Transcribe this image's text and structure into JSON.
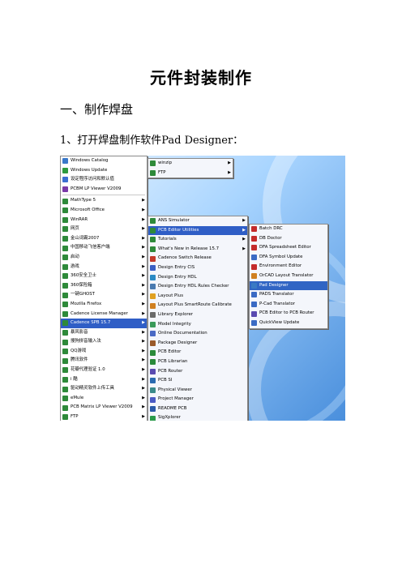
{
  "doc": {
    "title": "元件封装制作",
    "section": "一、制作焊盘",
    "step": "1、打开焊盘制作软件Pad Designer："
  },
  "start_menu": {
    "pinned": [
      {
        "label": "Windows Catalog",
        "icon": "catalog-icon",
        "color": "#3a78c9"
      },
      {
        "label": "Windows Update",
        "icon": "update-icon",
        "color": "#2d9a3e"
      },
      {
        "label": "设定程序访问和默认值",
        "icon": "defaults-icon",
        "color": "#3b6fd1"
      },
      {
        "label": "PCBM LP Viewer V2009",
        "icon": "viewer-icon",
        "color": "#7a3aa8"
      }
    ],
    "items": [
      {
        "label": "MathType 5",
        "icon": "program-folder-icon",
        "color": "#2e8a3a",
        "arrow": "▶"
      },
      {
        "label": "Microsoft Office",
        "icon": "program-folder-icon",
        "color": "#2e8a3a",
        "arrow": "▶"
      },
      {
        "label": "WinRAR",
        "icon": "program-folder-icon",
        "color": "#2e8a3a",
        "arrow": "▶"
      },
      {
        "label": "网页",
        "icon": "program-folder-icon",
        "color": "#2e8a3a",
        "arrow": "▶"
      },
      {
        "label": "金山词霸2007",
        "icon": "program-folder-icon",
        "color": "#2e8a3a",
        "arrow": "▶"
      },
      {
        "label": "中国移动飞信客户端",
        "icon": "program-folder-icon",
        "color": "#2e8a3a",
        "arrow": "▶"
      },
      {
        "label": "启动",
        "icon": "program-folder-icon",
        "color": "#2e8a3a",
        "arrow": "▶"
      },
      {
        "label": "游戏",
        "icon": "program-folder-icon",
        "color": "#2e8a3a",
        "arrow": "▶"
      },
      {
        "label": "360安全卫士",
        "icon": "program-folder-icon",
        "color": "#2e8a3a",
        "arrow": "▶"
      },
      {
        "label": "360保险箱",
        "icon": "program-folder-icon",
        "color": "#2e8a3a",
        "arrow": "▶"
      },
      {
        "label": "一键GHOST",
        "icon": "program-folder-icon",
        "color": "#2e8a3a",
        "arrow": "▶"
      },
      {
        "label": "Mozilla Firefox",
        "icon": "program-folder-icon",
        "color": "#2e8a3a",
        "arrow": "▶"
      },
      {
        "label": "Cadence License Manager",
        "icon": "program-folder-icon",
        "color": "#2e8a3a",
        "arrow": "▶"
      },
      {
        "label": "Cadence SPB 15.7",
        "icon": "program-folder-icon",
        "color": "#2e8a3a",
        "arrow": "▶",
        "active": true
      },
      {
        "label": "暴风影音",
        "icon": "program-folder-icon",
        "color": "#2e8a3a",
        "arrow": "▶"
      },
      {
        "label": "搜狗拼音输入法",
        "icon": "program-folder-icon",
        "color": "#2e8a3a",
        "arrow": "▶"
      },
      {
        "label": "QQ游戏",
        "icon": "program-folder-icon",
        "color": "#2e8a3a",
        "arrow": "▶"
      },
      {
        "label": "腾讯软件",
        "icon": "program-folder-icon",
        "color": "#2e8a3a",
        "arrow": "▶"
      },
      {
        "label": "花瓣代理验证 1.0",
        "icon": "program-folder-icon",
        "color": "#2e8a3a",
        "arrow": "▶"
      },
      {
        "label": "i 酷",
        "icon": "program-folder-icon",
        "color": "#2e8a3a",
        "arrow": "▶"
      },
      {
        "label": "驱动精灵软件上传工具",
        "icon": "program-folder-icon",
        "color": "#2e8a3a",
        "arrow": "▶"
      },
      {
        "label": "eMule",
        "icon": "program-folder-icon",
        "color": "#2e8a3a",
        "arrow": "▶"
      },
      {
        "label": "PCB Matrix LP Viewer V2009",
        "icon": "program-folder-icon",
        "color": "#2e8a3a",
        "arrow": "▶"
      },
      {
        "label": "FTP",
        "icon": "program-folder-icon",
        "color": "#2e8a3a",
        "arrow": "▶"
      }
    ]
  },
  "top_submenu": {
    "items": [
      {
        "label": "winzip",
        "icon": "program-folder-icon",
        "color": "#2e8a3a",
        "arrow": "▶"
      },
      {
        "label": "FTP",
        "icon": "program-folder-icon",
        "color": "#2e8a3a",
        "arrow": "▶"
      }
    ]
  },
  "cadence_menu": {
    "items": [
      {
        "label": "ANS Simulator",
        "icon": "program-folder-icon",
        "color": "#2e8a3a",
        "arrow": "▶"
      },
      {
        "label": "PCB Editor Utilities",
        "icon": "program-folder-icon",
        "color": "#2e8a3a",
        "arrow": "▶",
        "active": true
      },
      {
        "label": "Tutorials",
        "icon": "program-folder-icon",
        "color": "#2e8a3a",
        "arrow": "▶"
      },
      {
        "label": "What's New in Release 15.7",
        "icon": "program-folder-icon",
        "color": "#2e8a3a",
        "arrow": "▶"
      },
      {
        "label": "Cadence Switch Release",
        "icon": "switch-icon",
        "color": "#c43a2a",
        "arrow": ""
      },
      {
        "label": "Design Entry CIS",
        "icon": "capture-icon",
        "color": "#3a5fc4",
        "arrow": ""
      },
      {
        "label": "Design Entry HDL",
        "icon": "hdl-icon",
        "color": "#2a8ac4",
        "arrow": ""
      },
      {
        "label": "Design Entry HDL Rules Checker",
        "icon": "checker-icon",
        "color": "#4a7ab0",
        "arrow": ""
      },
      {
        "label": "Layout Plus",
        "icon": "layout-icon",
        "color": "#e0a020",
        "arrow": ""
      },
      {
        "label": "Layout Plus SmartRoute Calibrate",
        "icon": "smartroute-icon",
        "color": "#d08020",
        "arrow": ""
      },
      {
        "label": "Library Explorer",
        "icon": "library-icon",
        "color": "#6a6a6a",
        "arrow": ""
      },
      {
        "label": "Model Integrity",
        "icon": "model-icon",
        "color": "#3a9a5a",
        "arrow": ""
      },
      {
        "label": "Online Documentation",
        "icon": "docs-icon",
        "color": "#4a6ac4",
        "arrow": ""
      },
      {
        "label": "Package Designer",
        "icon": "package-icon",
        "color": "#9a5a2a",
        "arrow": ""
      },
      {
        "label": "PCB Editor",
        "icon": "pcb-icon",
        "color": "#2a8a3a",
        "arrow": ""
      },
      {
        "label": "PCB Librarian",
        "icon": "pcb-icon",
        "color": "#2a8a3a",
        "arrow": ""
      },
      {
        "label": "PCB Router",
        "icon": "router-icon",
        "color": "#5a4ab0",
        "arrow": ""
      },
      {
        "label": "PCB SI",
        "icon": "si-icon",
        "color": "#2a6ab0",
        "arrow": ""
      },
      {
        "label": "Physical Viewer",
        "icon": "viewer-icon",
        "color": "#3a8a8a",
        "arrow": ""
      },
      {
        "label": "Project Manager",
        "icon": "project-icon",
        "color": "#4a5ac4",
        "arrow": ""
      },
      {
        "label": "README PCB",
        "icon": "readme-icon",
        "color": "#2a5aa8",
        "arrow": ""
      },
      {
        "label": "SigXplorer",
        "icon": "sigxplorer-icon",
        "color": "#2a9a4a",
        "arrow": ""
      }
    ]
  },
  "utilities_menu": {
    "items": [
      {
        "label": "Batch DRC",
        "icon": "drc-icon",
        "color": "#c42a2a"
      },
      {
        "label": "DB Doctor",
        "icon": "doctor-icon",
        "color": "#c42a2a"
      },
      {
        "label": "DFA Spreadsheet Editor",
        "icon": "spreadsheet-icon",
        "color": "#c42a2a"
      },
      {
        "label": "DFA Symbol Update",
        "icon": "symbol-icon",
        "color": "#3a6ac4"
      },
      {
        "label": "Environment Editor",
        "icon": "environment-icon",
        "color": "#c42a2a"
      },
      {
        "label": "OrCAD Layout Translator",
        "icon": "translator-icon",
        "color": "#d08020"
      },
      {
        "label": "Pad Designer",
        "icon": "pad-designer-icon",
        "color": "#3a7ac4",
        "active": true
      },
      {
        "label": "PADS Translator",
        "icon": "translator-icon",
        "color": "#3a6ac4"
      },
      {
        "label": "P-Cad Translator",
        "icon": "translator-icon",
        "color": "#3a6ac4"
      },
      {
        "label": "PCB Editor to PCB Router",
        "icon": "router-icon",
        "color": "#5a4ab0"
      },
      {
        "label": "QuickView Update",
        "icon": "quickview-icon",
        "color": "#3a6ac4"
      }
    ]
  }
}
